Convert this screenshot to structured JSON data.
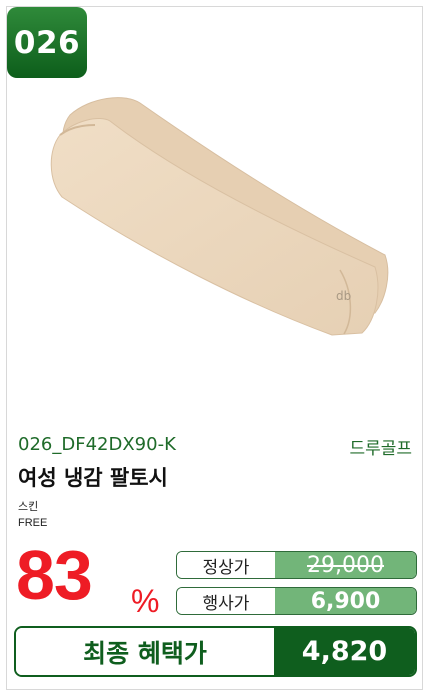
{
  "badge": {
    "number": "026"
  },
  "product": {
    "code": "026_DF42DX90-K",
    "brand": "드루골프",
    "name": "여성 냉감 팔토시",
    "color": "스킨",
    "size": "FREE",
    "image_icon": "arm-sleeve-product-image"
  },
  "pricing": {
    "discount_rate": "83",
    "discount_unit": "%",
    "regular_label": "정상가",
    "regular_price": "29,000",
    "sale_label": "행사가",
    "sale_price": "6,900",
    "final_label": "최종 혜택가",
    "final_price": "4,820"
  },
  "colors": {
    "accent_green": "#0f5e1e",
    "light_green": "#72b579",
    "discount_red": "#ee1c25",
    "sleeve_beige": "#ecd7bd"
  }
}
